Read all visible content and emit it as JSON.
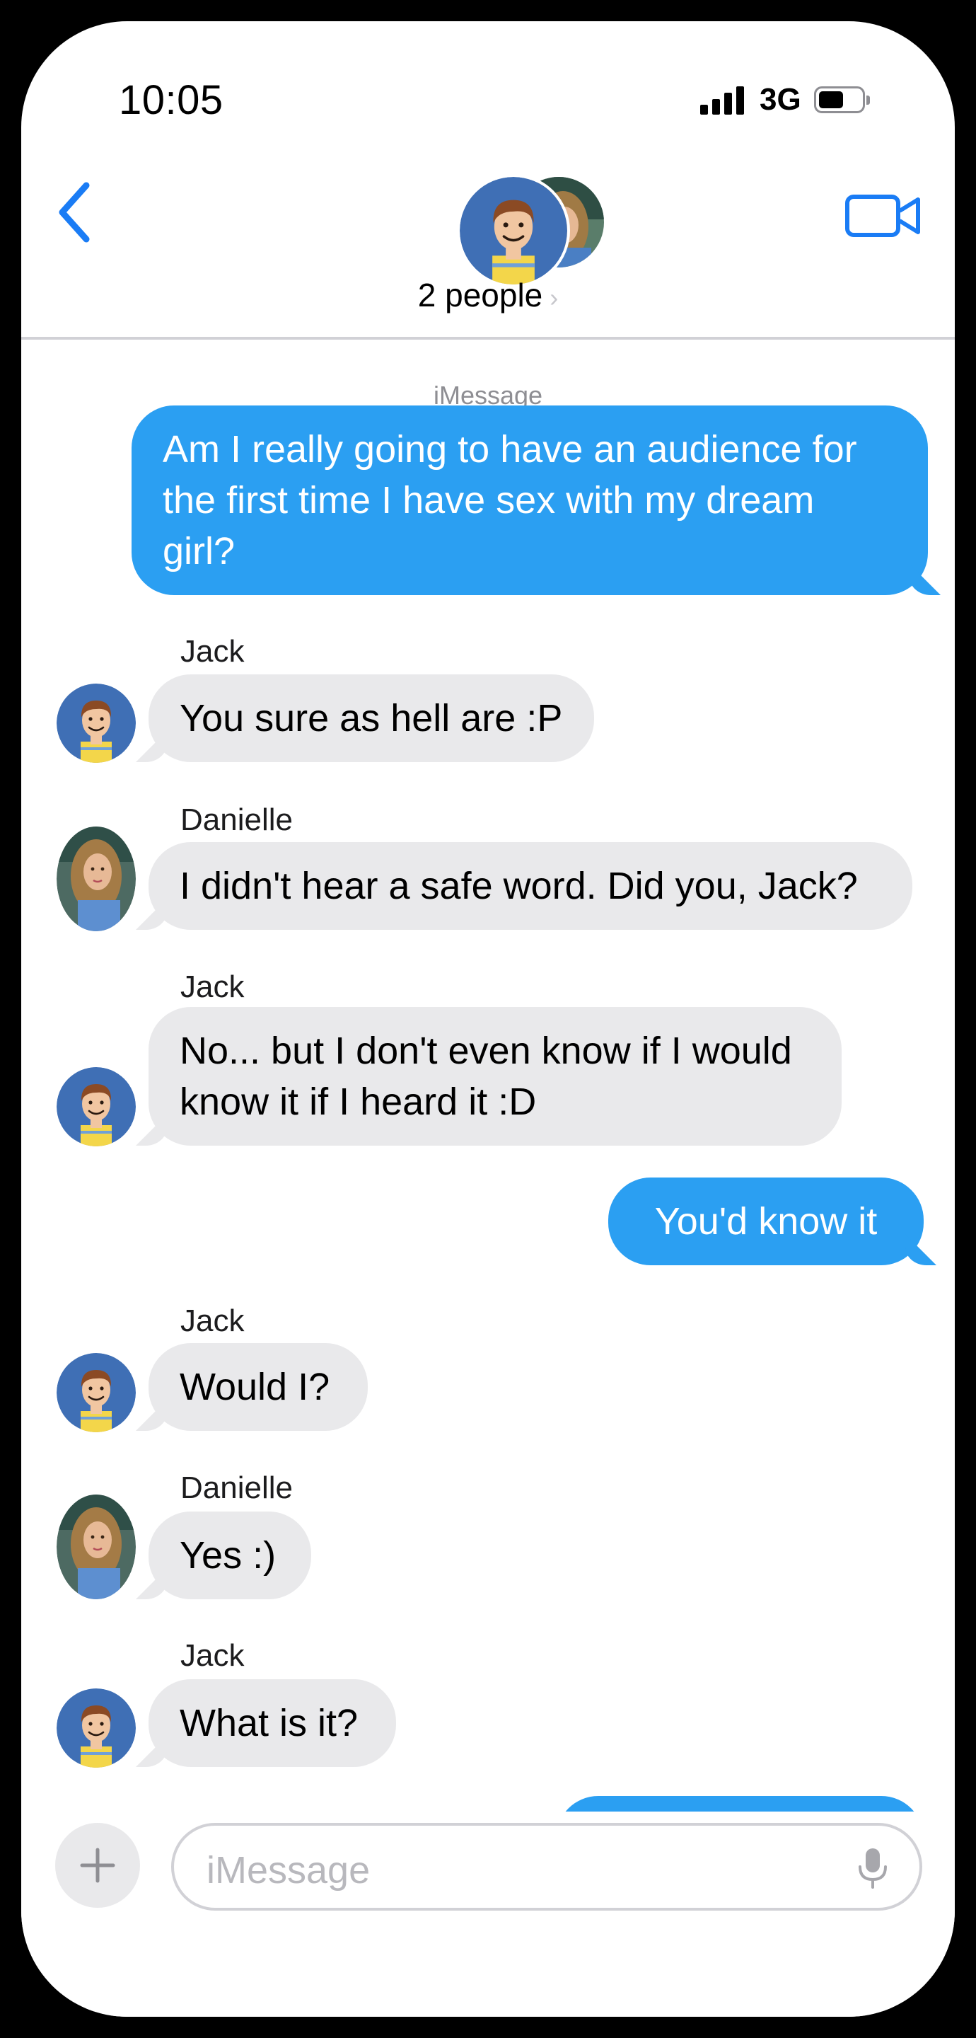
{
  "status_bar": {
    "time": "10:05",
    "network": "3G",
    "signal_bars": 4,
    "battery_level": 0.6
  },
  "header": {
    "group_label": "2 people",
    "back_icon": "chevron-left-icon",
    "video_icon": "video-camera-icon",
    "accent_color": "#1a7cf5"
  },
  "thread": {
    "service_label": "iMessage",
    "messages": [
      {
        "direction": "outgoing",
        "text": "Am I really going to have an audience for the first time I have sex with my dream girl?"
      },
      {
        "direction": "incoming",
        "sender": "Jack",
        "text": "You sure as hell are :P"
      },
      {
        "direction": "incoming",
        "sender": "Danielle",
        "text": "I didn't hear a safe word.  Did you, Jack?"
      },
      {
        "direction": "incoming",
        "sender": "Jack",
        "text": "No... but I don't even know if I would know it if I heard it :D"
      },
      {
        "direction": "outgoing",
        "text": "You'd know it"
      },
      {
        "direction": "incoming",
        "sender": "Jack",
        "text": "Would I?"
      },
      {
        "direction": "incoming",
        "sender": "Danielle",
        "text": "Yes :)"
      },
      {
        "direction": "incoming",
        "sender": "Jack",
        "text": "What is it?"
      }
    ],
    "outgoing_color": "#2b9ff2",
    "incoming_color": "#e9e9eb"
  },
  "composer": {
    "placeholder": "iMessage",
    "plus_icon": "plus-icon",
    "mic_icon": "microphone-icon"
  }
}
